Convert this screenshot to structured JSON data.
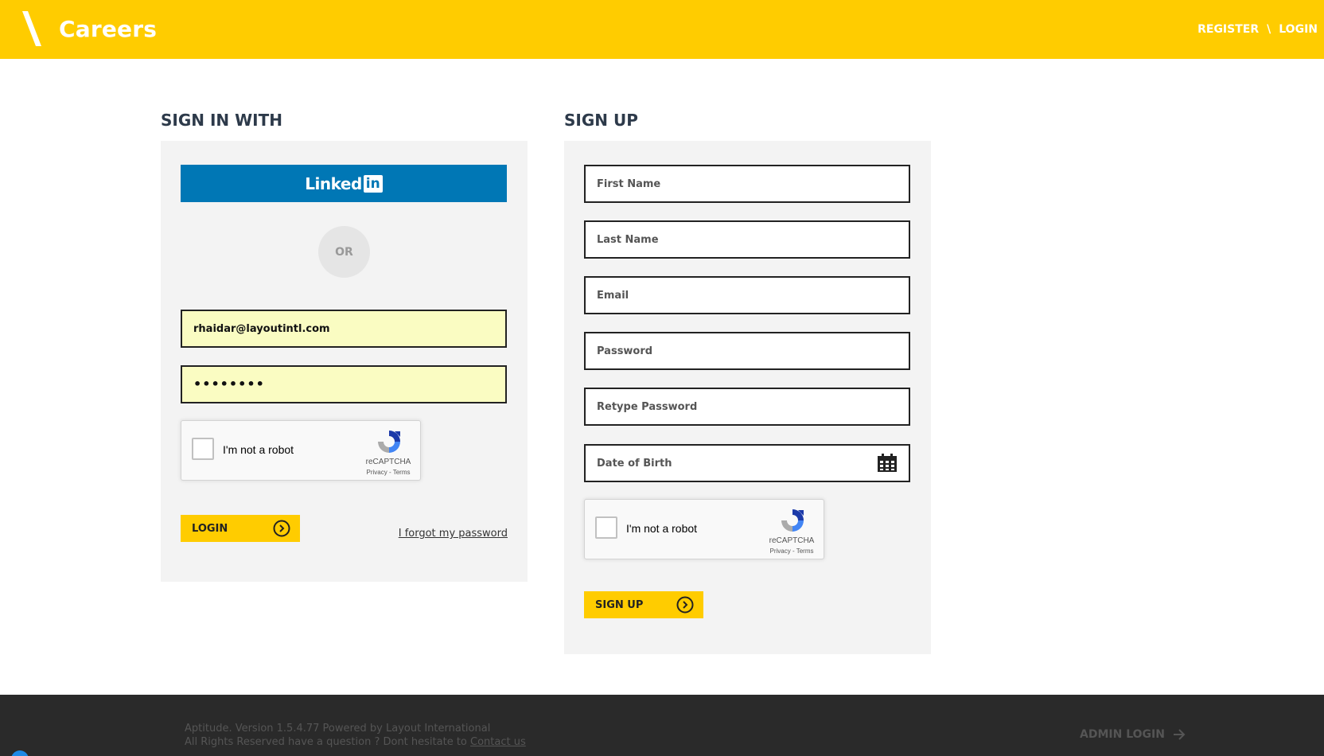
{
  "header": {
    "brand": "Careers",
    "nav": {
      "register": "REGISTER",
      "separator": "\\",
      "login": "LOGIN"
    },
    "accent_color": "#ffcc00"
  },
  "signin": {
    "title": "SIGN IN WITH",
    "linkedin": {
      "word": "Linked",
      "box": "in"
    },
    "or_label": "OR",
    "email_value": "rhaidar@layoutintl.com",
    "password_value": "••••••••",
    "recaptcha": {
      "label": "I'm not a robot",
      "brand": "reCAPTCHA",
      "links": "Privacy - Terms"
    },
    "login_button": "LOGIN",
    "forgot_link": "I forgot my password"
  },
  "signup": {
    "title": "SIGN UP",
    "fields": {
      "first_name": "First Name",
      "last_name": "Last Name",
      "email": "Email",
      "password": "Password",
      "retype_password": "Retype Password",
      "date_of_birth": "Date of Birth"
    },
    "recaptcha": {
      "label": "I'm not a robot",
      "brand": "reCAPTCHA",
      "links": "Privacy - Terms"
    },
    "signup_button": "SIGN UP"
  },
  "footer": {
    "line1": "Aptitude. Version 1.5.4.77 Powered by Layout International",
    "line2_prefix": "All Rights Reserved have a question ? Dont hesitate to ",
    "contact_link": "Contact us",
    "admin_login": "ADMIN LOGIN"
  }
}
